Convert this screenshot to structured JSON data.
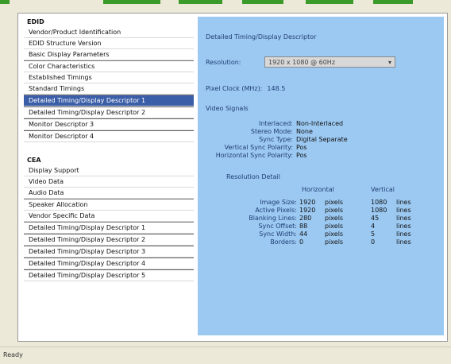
{
  "left_panel": {
    "section1_title": "EDID",
    "section1_items": [
      "Vendor/Product Identification",
      "EDID Structure Version",
      "Basic Display Parameters",
      "Color Characteristics",
      "Established Timings",
      "Standard Timings",
      "Detailed Timing/Display Descriptor 1",
      "Detailed Timing/Display Descriptor 2",
      "Monitor Descriptor 3",
      "Monitor Descriptor 4"
    ],
    "section2_title": "CEA",
    "section2_items": [
      "Display Support",
      "Video Data",
      "Audio Data",
      "Speaker Allocation",
      "Vendor Specific Data",
      "Detailed Timing/Display Descriptor 1",
      "Detailed Timing/Display Descriptor 2",
      "Detailed Timing/Display Descriptor 3",
      "Detailed Timing/Display Descriptor 4",
      "Detailed Timing/Display Descriptor 5"
    ],
    "selected_index": 6
  },
  "detail": {
    "title": "Detailed Timing/Display Descriptor",
    "resolution_label": "Resolution:",
    "resolution_value": "1920 x 1080 @ 60Hz",
    "pixel_clock_label": "Pixel Clock (MHz):",
    "pixel_clock_value": "148.5",
    "signals_title": "Video Signals",
    "signals": [
      {
        "k": "Interlaced:",
        "v": "Non-Interlaced"
      },
      {
        "k": "Stereo Mode:",
        "v": "None"
      },
      {
        "k": "Sync Type:",
        "v": "Digital Separate"
      },
      {
        "k": "Vertical Sync Polarity:",
        "v": "Pos"
      },
      {
        "k": "Horizontal Sync Polarity:",
        "v": "Pos"
      }
    ],
    "resolution_details_title": "Resolution Detail",
    "col_horizontal": "Horizontal",
    "col_vertical": "Vertical",
    "rows": [
      {
        "label": "Image Size:",
        "h": "1920",
        "hu": "pixels",
        "v": "1080",
        "vu": "lines"
      },
      {
        "label": "Active Pixels:",
        "h": "1920",
        "hu": "pixels",
        "v": "1080",
        "vu": "lines"
      },
      {
        "label": "Blanking Lines:",
        "h": "280",
        "hu": "pixels",
        "v": "45",
        "vu": "lines"
      },
      {
        "label": "Sync Offset:",
        "h": "88",
        "hu": "pixels",
        "v": "4",
        "vu": "lines"
      },
      {
        "label": "Sync Width:",
        "h": "44",
        "hu": "pixels",
        "v": "5",
        "vu": "lines"
      },
      {
        "label": "Borders:",
        "h": "0",
        "hu": "pixels",
        "v": "0",
        "vu": "lines"
      }
    ]
  },
  "status": {
    "text": "Ready"
  }
}
